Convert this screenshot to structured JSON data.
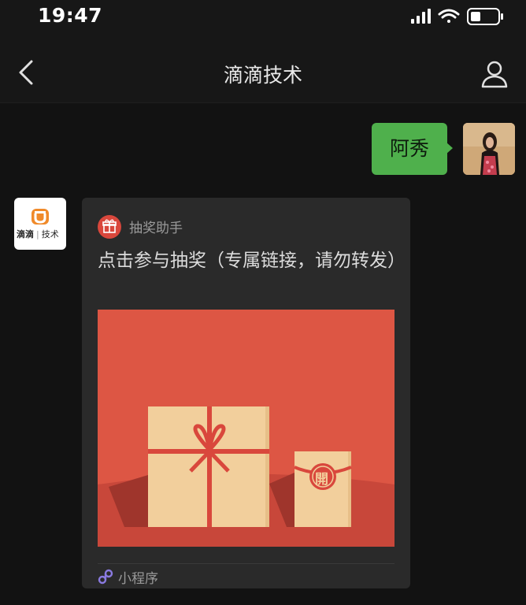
{
  "status_bar": {
    "time": "19:47"
  },
  "nav": {
    "title": "滴滴技术"
  },
  "messages": {
    "sent": {
      "text": "阿秀"
    },
    "received": {
      "avatar_text": "滴滴",
      "avatar_subtext": "技术",
      "card": {
        "app_name": "抽奖助手",
        "title": "点击参与抽奖（专属链接，请勿转发）",
        "seal_char": "開",
        "footer_label": "小程序"
      }
    }
  },
  "colors": {
    "bubble_green": "#4fb04c",
    "cover_red": "#dd5644",
    "box_beige": "#f2cf9c",
    "ribbon_red": "#d9473c"
  }
}
